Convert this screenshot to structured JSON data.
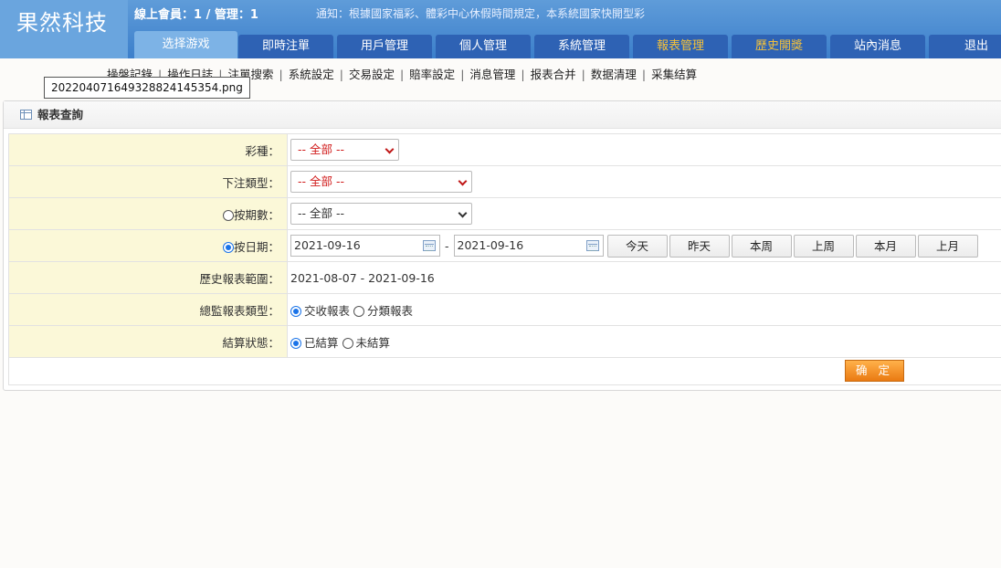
{
  "header": {
    "logo": "果然科技",
    "online_status": "線上會員：1 / 管理：1",
    "notice": "通知：根據國家福彩、體彩中心休假時間規定，本系統國家快開型彩"
  },
  "tabs": [
    {
      "label": "选择游戏"
    },
    {
      "label": "即時注單"
    },
    {
      "label": "用戶管理"
    },
    {
      "label": "個人管理"
    },
    {
      "label": "系統管理"
    },
    {
      "label": "報表管理"
    },
    {
      "label": "歷史開獎"
    },
    {
      "label": "站內消息"
    },
    {
      "label": "退出"
    }
  ],
  "subnav": [
    "操盤記錄",
    "操作日誌",
    "注單搜索",
    "系統設定",
    "交易設定",
    "賠率設定",
    "消息管理",
    "报表合并",
    "数据清理",
    "采集结算"
  ],
  "tooltip": "20220407164932882414535​4.png",
  "panel": {
    "title": "報表查詢",
    "lottery_label": "彩種：",
    "lottery_value": "-- 全部 --",
    "bet_type_label": "下注類型：",
    "bet_type_value": "-- 全部 --",
    "period_label": "按期數：",
    "period_value": "-- 全部 --",
    "date_label": "按日期：",
    "date_from": "2021-09-16",
    "date_to": "2021-09-16",
    "date_sep": "-",
    "quick": [
      "今天",
      "昨天",
      "本周",
      "上周",
      "本月",
      "上月"
    ],
    "range_label": "歷史報表範圍：",
    "range_value": "2021-08-07 - 2021-09-16",
    "report_type_label": "總監報表類型：",
    "report_type_opt1": "交收報表",
    "report_type_opt2": "分類報表",
    "settle_label": "結算狀態：",
    "settle_opt1": "已結算",
    "settle_opt2": "未結算",
    "confirm": "确 定"
  }
}
